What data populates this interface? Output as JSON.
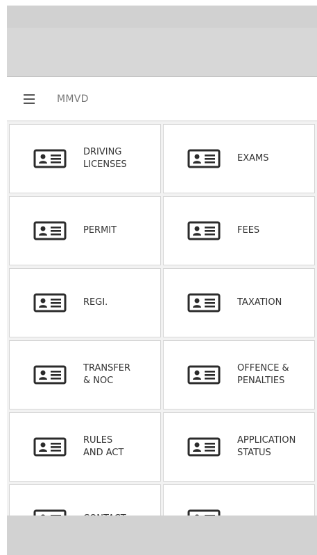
{
  "toolbar": {
    "menu_icon": "hamburger-menu-icon",
    "title": "MMVD"
  },
  "tile_icon": "id-card-icon",
  "tiles": [
    {
      "label": "DRIVING\nLICENSES"
    },
    {
      "label": "EXAMS"
    },
    {
      "label": "PERMIT"
    },
    {
      "label": "FEES"
    },
    {
      "label": "REGI."
    },
    {
      "label": "TAXATION"
    },
    {
      "label": "TRANSFER\n& NOC"
    },
    {
      "label": "OFFENCE &\nPENALTIES"
    },
    {
      "label": "RULES\nAND ACT"
    },
    {
      "label": "APPLICATION\nSTATUS"
    },
    {
      "label": "CONTACT"
    },
    {
      "label": ""
    }
  ],
  "colors": {
    "icon": "#2b2b2b",
    "tile_bg": "#ffffff",
    "grid_bg": "#f2f2f2"
  }
}
